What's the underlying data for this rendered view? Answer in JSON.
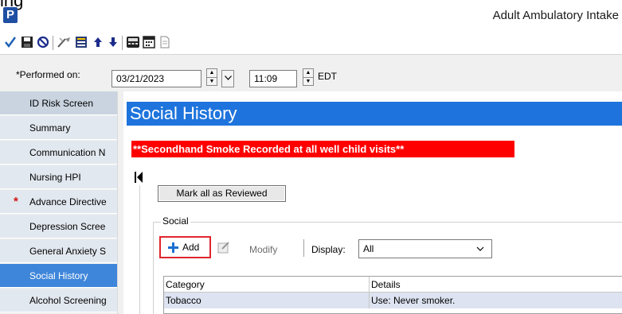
{
  "window": {
    "app_icon_letter": "P",
    "clipped_text": "ing",
    "title": "Adult Ambulatory Intake"
  },
  "toolbar": {
    "buttons": [
      "checkmark-icon",
      "save-icon",
      "cancel-icon",
      "edit-icon",
      "form-icon",
      "arrow-up-icon",
      "arrow-down-icon",
      "calculator-icon",
      "calendar-icon",
      "document-icon"
    ]
  },
  "performed": {
    "label": "*Performed on:",
    "date": "03/21/2023",
    "time": "11:09",
    "timezone": "EDT"
  },
  "nav": {
    "items": [
      {
        "label": "ID Risk Screen",
        "required": false
      },
      {
        "label": "Summary",
        "required": false
      },
      {
        "label": "Communication N",
        "required": false
      },
      {
        "label": "Nursing HPI",
        "required": false
      },
      {
        "label": "Advance Directive",
        "required": true
      },
      {
        "label": "Depression Scree",
        "required": false
      },
      {
        "label": "General Anxiety S",
        "required": false
      },
      {
        "label": "Social History",
        "required": false
      },
      {
        "label": "Alcohol Screening",
        "required": false
      }
    ],
    "active_index": 7
  },
  "main": {
    "section_title": "Social History",
    "alert": "**Secondhand Smoke Recorded at all well child visits**",
    "review_button": "Mark all as Reviewed",
    "social_group_label": "Social",
    "add_label": "Add",
    "modify_label": "Modify",
    "display_label": "Display:",
    "display_value": "All",
    "grid": {
      "columns": [
        "Category",
        "Details"
      ],
      "rows": [
        [
          "Tobacco",
          "Use: Never smoker."
        ]
      ]
    }
  },
  "colors": {
    "section_header_bg": "#1e74dc",
    "alert_bg": "#ff0000",
    "nav_active_bg": "#3e86da",
    "add_highlight_border": "#e0262c",
    "grid_row_bg": "#dde3f0"
  }
}
